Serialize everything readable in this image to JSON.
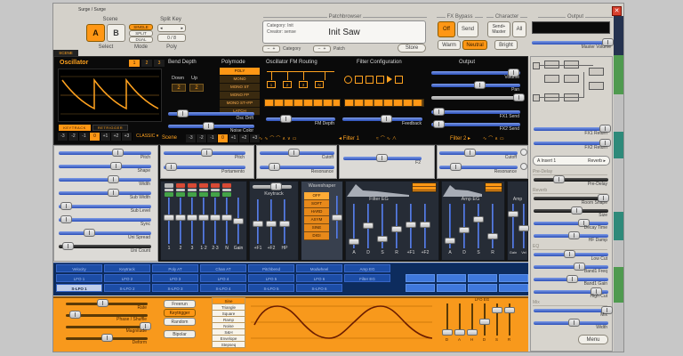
{
  "window": {
    "title": "Surge / Surge",
    "close_glyph": "✕"
  },
  "glyphs": {
    "left": "◂",
    "right": "▸",
    "minus": "−",
    "plus": "+"
  },
  "header": {
    "scene_label": "Scene",
    "split_key_label": "Split Key",
    "scene_a": "A",
    "scene_b": "B",
    "modes": [
      "SINGLE",
      "SPLIT",
      "DUAL"
    ],
    "poly_value": "0 / 8",
    "select_label": "Select",
    "mode_label": "Mode",
    "poly_label": "Poly",
    "patchbrowser": {
      "group_label": "Patchbrowser",
      "category": "Category: Init",
      "creator": "Creator: sense",
      "patch_name": "Init Saw",
      "category_nav": "Category",
      "patch_nav": "Patch",
      "store_label": "Store"
    },
    "fx_bypass": {
      "group_label": "FX Bypass",
      "off": "Off",
      "send": "Send",
      "send_plus": "Send+",
      "master": "Master",
      "all": "All"
    },
    "character": {
      "group_label": "Character",
      "options": [
        "Warm",
        "Neutral",
        "Bright"
      ]
    },
    "output": {
      "group_label": "Output",
      "master_label": "Master Volume"
    }
  },
  "scene_tab": "SCENE",
  "octaves": [
    "-3",
    "-2",
    "-1",
    "0",
    "+1",
    "+2",
    "+3"
  ],
  "oscillator": {
    "title": "Oscillator",
    "tabs": [
      "1",
      "2",
      "3"
    ],
    "keytrack": "KEYTRACK",
    "retrigger": "RETRIGGER",
    "type": "CLASSIC ▾"
  },
  "bend": {
    "title": "Bend Depth",
    "down": "Down",
    "up": "Up",
    "down_value": "2",
    "up_value": "2"
  },
  "polymode": {
    "title": "Polymode",
    "items": [
      "POLY",
      "MONO",
      "MONO ST",
      "MONO FP",
      "MONO ST+FP",
      "LATCH"
    ]
  },
  "scene_params": {
    "osc_drift": "Osc Drift",
    "noise_color": "Noise Color"
  },
  "fm": {
    "title": "Oscillator FM Routing",
    "depth_label": "FM Depth",
    "nodes": [
      "1",
      "2",
      "3",
      "N"
    ]
  },
  "filter_config": {
    "title": "Filter Configuration",
    "feedback_label": "Feedback"
  },
  "output_section": {
    "title": "Output",
    "volume": "Volume",
    "pan": "Pan",
    "fx1_send": "FX1 Send",
    "fx2_send": "FX2 Send"
  },
  "filter_strip": {
    "scene_label": "Scene",
    "filter1_label": "◂ Filter 1",
    "filter2_label": "Filter 2 ▸"
  },
  "left_sliders": [
    "Pitch",
    "Shape",
    "Width",
    "Sub Width",
    "Sub Level",
    "Sync",
    "Uni Spread",
    "Uni Count"
  ],
  "pitch_block": {
    "pitch": "Pitch",
    "portamento": "Portamento"
  },
  "filter1_block": {
    "cutoff": "Cutoff",
    "resonance": "Resonance"
  },
  "f2_block": {
    "label": "F2"
  },
  "filter2_block": {
    "cutoff": "Cutoff",
    "resonance": "Resonance"
  },
  "mixer": {
    "channels": [
      "1",
      "2",
      "3",
      "1·2",
      "2·3",
      "N"
    ],
    "gain_label": "Gain"
  },
  "keytrack": {
    "title": "Keytrack",
    "labels": [
      "+F1",
      "+F2",
      "HP"
    ]
  },
  "waveshaper": {
    "title": "Waveshaper",
    "items": [
      "OFF",
      "SOFT",
      "HARD",
      "ASYM",
      "SINE",
      "DIGI"
    ]
  },
  "filter_eg": {
    "title": "Filter EG",
    "labels": [
      "A",
      "D",
      "S",
      "R",
      "+F1",
      "+F2"
    ]
  },
  "amp_eg": {
    "title": "Amp EG",
    "labels": [
      "A",
      "D",
      "S",
      "R"
    ]
  },
  "amp": {
    "title": "Amp",
    "labels": [
      "Gain",
      "Vel"
    ]
  },
  "mod_matrix": {
    "rows": [
      [
        "Velocity",
        "Keytrack",
        "Poly AT",
        "Chan AT",
        "Pitchbend",
        "Modwheel",
        "Amp EG"
      ],
      [
        "LFO 1",
        "LFO 2",
        "LFO 3",
        "LFO 4",
        "LFO 5",
        "LFO 6",
        "Filter EG"
      ],
      [
        "S-LFO 1",
        "S-LFO 2",
        "S-LFO 3",
        "S-LFO 4",
        "S-LFO 5",
        "S-LFO 6"
      ]
    ],
    "macro_cells": [
      "",
      "",
      "",
      "",
      "",
      "",
      "",
      ""
    ],
    "selected": "S-LFO 1"
  },
  "lfo": {
    "sliders": [
      "Rate",
      "Phase / Shuffle",
      "Magnitude",
      "Deform"
    ],
    "triggers": [
      "Freerun",
      "Keytrigger",
      "Random"
    ],
    "bipolar": "Bipolar",
    "shapes": [
      "Sine",
      "Triangle",
      "Square",
      "Ramp",
      "Noise",
      "S&H",
      "Envelope",
      "Stepseq"
    ],
    "eg_title": "LFO EG",
    "eg_labels": [
      "D",
      "A",
      "H",
      "D",
      "S",
      "R"
    ]
  },
  "fx_panel": {
    "fx1_return": "FX1 Return",
    "fx2_return": "FX2 Return",
    "insert_slot": "A Insert 1",
    "insert_type": "Reverb ▸",
    "groups": [
      {
        "name": "Pre-Delay",
        "sliders": [
          "Pre-Delay"
        ]
      },
      {
        "name": "Reverb",
        "sliders": [
          "Room Shape",
          "Size",
          "Decay Time",
          "HF Damp"
        ]
      },
      {
        "name": "EQ",
        "sliders": [
          "Low Cut",
          "Band1 Freq",
          "Band1 Gain",
          "High Cut"
        ]
      },
      {
        "name": "Mix",
        "sliders": [
          "Mix",
          "Width"
        ]
      }
    ],
    "menu_label": "Menu"
  },
  "colors": {
    "accent": "#ff9715",
    "mod_blue": "#1c4da6",
    "lfo_orange": "#f8991c"
  }
}
